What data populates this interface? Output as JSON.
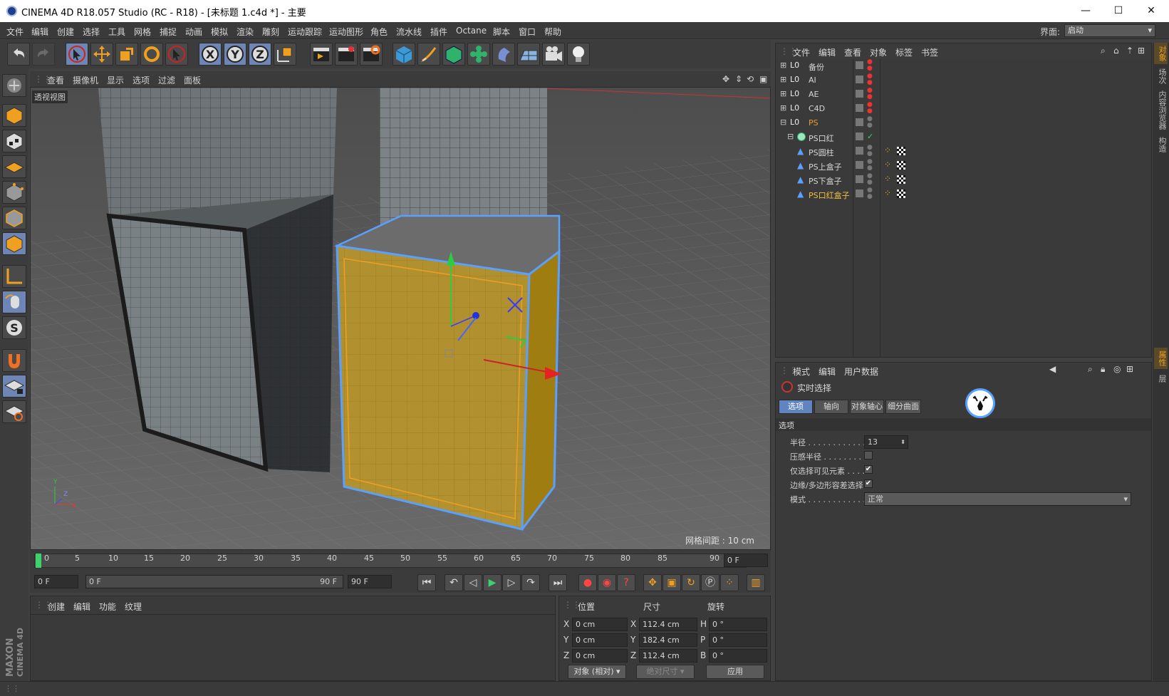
{
  "title_bar": {
    "title": "CINEMA 4D R18.057 Studio (RC - R18) - [未标题 1.c4d *] - 主要",
    "minimize": "—",
    "maximize": "☐",
    "close": "✕"
  },
  "menu": {
    "items": [
      "文件",
      "编辑",
      "创建",
      "选择",
      "工具",
      "网格",
      "捕捉",
      "动画",
      "模拟",
      "渲染",
      "雕刻",
      "运动跟踪",
      "运动图形",
      "角色",
      "流水线",
      "插件",
      "Octane",
      "脚本",
      "窗口",
      "帮助"
    ],
    "interface_label": "界面:",
    "interface_value": "启动"
  },
  "viewport": {
    "menu": [
      "查看",
      "摄像机",
      "显示",
      "选项",
      "过滤",
      "面板"
    ],
    "label": "透视视图",
    "grid_distance": "网格间距 : 10 cm"
  },
  "timeline": {
    "ticks": [
      "0",
      "5",
      "10",
      "15",
      "20",
      "25",
      "30",
      "35",
      "40",
      "45",
      "50",
      "55",
      "60",
      "65",
      "70",
      "75",
      "80",
      "85",
      "90"
    ],
    "current_frame": "0 F"
  },
  "playback": {
    "start": "0 F",
    "range_start": "0 F",
    "range_end": "90 F",
    "end": "90 F"
  },
  "material_panel": {
    "menu": [
      "创建",
      "编辑",
      "功能",
      "纹理"
    ]
  },
  "coord_panel": {
    "headers": [
      "位置",
      "尺寸",
      "旋转"
    ],
    "rows": [
      {
        "axis": "X",
        "pos": "0 cm",
        "size_axis": "X",
        "size": "112.4 cm",
        "rot_axis": "H",
        "rot": "0 °"
      },
      {
        "axis": "Y",
        "pos": "0 cm",
        "size_axis": "Y",
        "size": "182.4 cm",
        "rot_axis": "P",
        "rot": "0 °"
      },
      {
        "axis": "Z",
        "pos": "0 cm",
        "size_axis": "Z",
        "size": "112.4 cm",
        "rot_axis": "B",
        "rot": "0 °"
      }
    ],
    "mode": "对象 (相对)",
    "size_mode": "绝对尺寸",
    "apply": "应用"
  },
  "object_manager": {
    "menu": [
      "文件",
      "编辑",
      "查看",
      "对象",
      "标签",
      "书签"
    ],
    "objects": [
      {
        "name": "备份",
        "indent": 0,
        "color": "#d6d6d6"
      },
      {
        "name": "AI",
        "indent": 0,
        "color": "#d6d6d6"
      },
      {
        "name": "AE",
        "indent": 0,
        "color": "#d6d6d6"
      },
      {
        "name": "C4D",
        "indent": 0,
        "color": "#d6d6d6"
      },
      {
        "name": "PS",
        "indent": 0,
        "color": "#e0a030"
      },
      {
        "name": "PS口红",
        "indent": 1,
        "color": "#d6d6d6"
      },
      {
        "name": "PS圆柱",
        "indent": 2,
        "color": "#d6d6d6"
      },
      {
        "name": "PS上盒子",
        "indent": 2,
        "color": "#d6d6d6"
      },
      {
        "name": "PS下盒子",
        "indent": 2,
        "color": "#d6d6d6"
      },
      {
        "name": "PS口红盒子",
        "indent": 2,
        "color": "#f0c040"
      }
    ]
  },
  "attribute_manager": {
    "menu": [
      "模式",
      "编辑",
      "用户数据"
    ],
    "tool_name": "实时选择",
    "tabs": [
      "选项",
      "轴向",
      "对象轴心",
      "细分曲面"
    ],
    "section": "选项",
    "fields": {
      "radius_label": "半径 . . . . . . . . . . . . .",
      "radius_value": "13",
      "pressure_label": "压感半径 . . . . . . . . .",
      "visible_only_label": "仅选择可见元素 . . . .",
      "visible_only_check": "✔",
      "edge_tolerance_label": "边缘/多边形容差选择",
      "edge_tolerance_check": "✔",
      "mode_label": "模式 . . . . . . . . . . . . .",
      "mode_value": "正常"
    },
    "badge_text": "行走者"
  },
  "right_tabs": [
    "对象",
    "场次",
    "内容浏览器",
    "构造",
    "属性",
    "层"
  ],
  "branding": "MAXON CINEMA 4D"
}
